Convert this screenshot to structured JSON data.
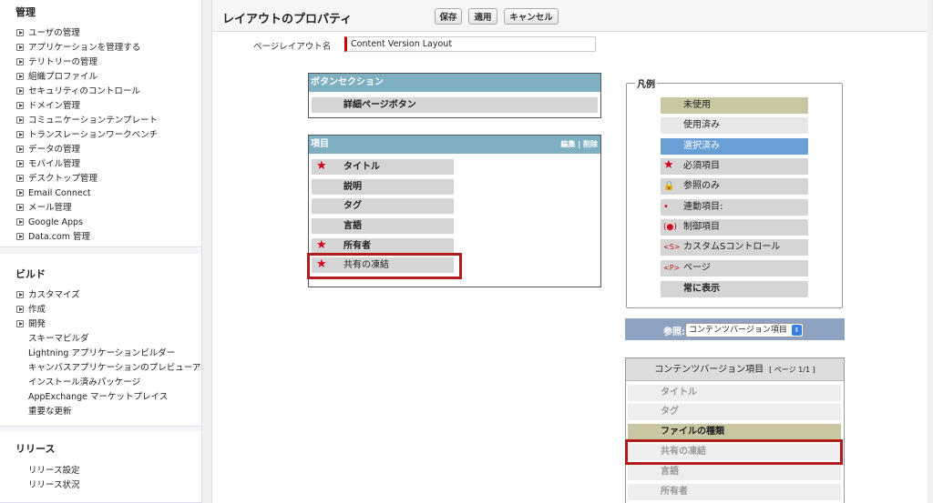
{
  "sidebar": {
    "admin_title": "管理",
    "admin_items": [
      "ユーザの管理",
      "アプリケーションを管理する",
      "テリトリーの管理",
      "組織プロファイル",
      "セキュリティのコントロール",
      "ドメイン管理",
      "コミュニケーションテンプレート",
      "トランスレーションワークベンチ",
      "データの管理",
      "モバイル管理",
      "デスクトップ管理",
      "Email Connect",
      "メール管理",
      "Google Apps",
      "Data.com 管理"
    ],
    "build_title": "ビルド",
    "build_items": [
      "カスタマイズ",
      "作成",
      "開発"
    ],
    "build_sub_items": [
      "スキーマビルダ",
      "Lightning アプリケーションビルダー",
      "キャンバスアプリケーションのプレビューア",
      "インストール済みパッケージ",
      "AppExchange マーケットプレイス",
      "重要な更新"
    ],
    "release_title": "リリース",
    "release_sub_items": [
      "リリース設定",
      "リリース状況"
    ]
  },
  "header": {
    "title": "レイアウトのプロパティ",
    "save_label": "保存",
    "apply_label": "適用",
    "cancel_label": "キャンセル"
  },
  "layout_name": {
    "label": "ページレイアウト名",
    "value": "Content Version Layout"
  },
  "button_section": {
    "title": "ボタンセクション",
    "button_label": "詳細ページボタン"
  },
  "fields_section": {
    "title": "項目",
    "edit_label": "編集",
    "separator": "|",
    "delete_label": "削除",
    "fields": [
      "タイトル",
      "説明",
      "タグ",
      "言語",
      "所有者",
      "共有の凍結"
    ]
  },
  "legend": {
    "title": "凡例",
    "unused": "未使用",
    "used": "使用済み",
    "selected": "選択済み",
    "required": "必須項目",
    "readonly": "参照のみ",
    "dependent": "連動項目:",
    "controlling": "制御項目",
    "s_control": "カスタムSコントロール",
    "page": "ページ",
    "always_display": "常に表示",
    "colors": {
      "unused": "#c9c6a2",
      "used": "#e8e8e8",
      "selected": "#6a9fd6",
      "field": "#d5d5d5"
    }
  },
  "reference": {
    "label": "参照:",
    "selected": "コンテンツバージョン項目"
  },
  "palette": {
    "title": "コンテンツバージョン項目",
    "page_info": "[ ページ 1/1 ]",
    "items": [
      "タイトル",
      "タグ",
      "ファイルの種類",
      "共有の凍結",
      "言語",
      "所有者"
    ]
  }
}
